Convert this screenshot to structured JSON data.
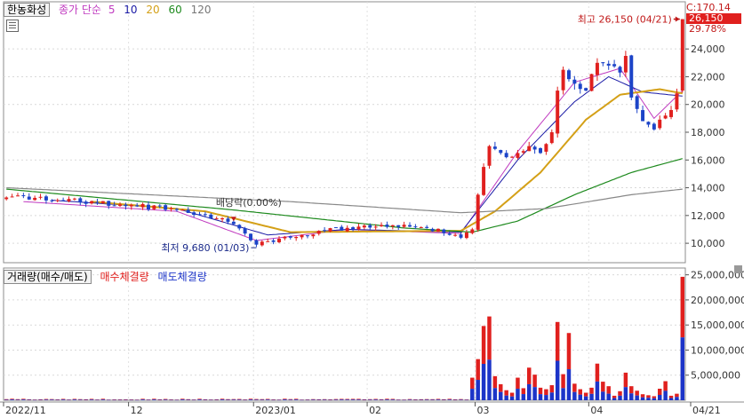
{
  "legend_price": {
    "stock_name": "한농화성",
    "ma_prefix": "종가 단순",
    "ma_periods": [
      "5",
      "10",
      "20",
      "60",
      "120"
    ],
    "ma_colors": [
      "#c03bc0",
      "#1a1aa6",
      "#d4a017",
      "#1e8a1e",
      "#888888"
    ]
  },
  "legend_volume": {
    "label": "거래량(매수/매도)",
    "buy_label": "매수체결량",
    "sell_label": "매도체결량"
  },
  "price_box": {
    "top_value": "C:170.14",
    "current": "26,150",
    "change": "29.78%"
  },
  "colors": {
    "up": "#e0201e",
    "down": "#1c44c8",
    "buy": "#e0201e",
    "sell": "#1c34c8"
  },
  "chart_data": [
    {
      "type": "candlestick",
      "y_ticks": [
        10000,
        12000,
        14000,
        16000,
        18000,
        20000,
        22000,
        24000
      ],
      "y_tick_labels": [
        "10,000",
        "12,000",
        "14,000",
        "16,000",
        "18,000",
        "20,000",
        "22,000",
        "24,000"
      ],
      "ylim": [
        8600,
        27400
      ],
      "x_labels": [
        "2022/11",
        "12",
        "2023/01",
        "02",
        "03",
        "04",
        "04/21"
      ],
      "x_label_days": [
        0,
        22,
        44,
        64,
        83,
        103,
        119
      ],
      "annotations": {
        "high": {
          "text": "최고 26,150 (04/21)",
          "day": 119,
          "value": 26150
        },
        "low": {
          "text": "최저 9,680 (01/03)",
          "day": 44,
          "value": 9680
        },
        "dividend": {
          "text": "배당락(0.00%)",
          "day": 40,
          "value": 12550
        }
      },
      "anchors": [
        [
          0,
          13300
        ],
        [
          10,
          13100
        ],
        [
          20,
          12800
        ],
        [
          30,
          12400
        ],
        [
          38,
          11800
        ],
        [
          42,
          10700
        ],
        [
          44,
          9900
        ],
        [
          50,
          10400
        ],
        [
          56,
          10900
        ],
        [
          62,
          11200
        ],
        [
          68,
          11300
        ],
        [
          74,
          11100
        ],
        [
          79,
          10600
        ],
        [
          80,
          10400
        ],
        [
          82,
          11000
        ],
        [
          83,
          13500
        ],
        [
          84,
          15500
        ],
        [
          85,
          17000
        ],
        [
          86,
          16800
        ],
        [
          88,
          16200
        ],
        [
          90,
          16500
        ],
        [
          92,
          17000
        ],
        [
          94,
          16500
        ],
        [
          96,
          18000
        ],
        [
          97,
          21000
        ],
        [
          98,
          22500
        ],
        [
          100,
          21500
        ],
        [
          102,
          21000
        ],
        [
          104,
          23000
        ],
        [
          106,
          22800
        ],
        [
          108,
          22300
        ],
        [
          109,
          23500
        ],
        [
          110,
          20500
        ],
        [
          112,
          18800
        ],
        [
          114,
          18200
        ],
        [
          116,
          19200
        ],
        [
          117,
          19600
        ],
        [
          118,
          20800
        ],
        [
          119,
          26150
        ]
      ],
      "ma": {
        "ma5": [
          [
            3,
            13000
          ],
          [
            30,
            12300
          ],
          [
            44,
            10200
          ],
          [
            60,
            11000
          ],
          [
            80,
            10700
          ],
          [
            90,
            16600
          ],
          [
            100,
            21600
          ],
          [
            108,
            22600
          ],
          [
            114,
            19000
          ],
          [
            119,
            21000
          ]
        ],
        "ma10": [
          [
            8,
            13100
          ],
          [
            30,
            12500
          ],
          [
            46,
            10600
          ],
          [
            60,
            11000
          ],
          [
            80,
            10800
          ],
          [
            90,
            16000
          ],
          [
            100,
            20200
          ],
          [
            106,
            22000
          ],
          [
            112,
            20900
          ],
          [
            119,
            20600
          ]
        ],
        "ma20": [
          [
            15,
            13000
          ],
          [
            35,
            12300
          ],
          [
            50,
            10800
          ],
          [
            80,
            10900
          ],
          [
            86,
            12300
          ],
          [
            94,
            15100
          ],
          [
            102,
            18900
          ],
          [
            108,
            20700
          ],
          [
            115,
            21100
          ],
          [
            119,
            20800
          ]
        ],
        "ma60": [
          [
            0,
            13900
          ],
          [
            40,
            12400
          ],
          [
            70,
            11100
          ],
          [
            82,
            10800
          ],
          [
            90,
            11600
          ],
          [
            100,
            13500
          ],
          [
            110,
            15100
          ],
          [
            119,
            16100
          ]
        ],
        "ma120": [
          [
            0,
            14000
          ],
          [
            50,
            13000
          ],
          [
            80,
            12200
          ],
          [
            95,
            12500
          ],
          [
            110,
            13500
          ],
          [
            119,
            13900
          ]
        ]
      }
    },
    {
      "type": "bar",
      "series": [
        {
          "name": "매수체결량"
        },
        {
          "name": "매도체결량"
        }
      ],
      "y_ticks": [
        5000000,
        10000000,
        15000000,
        20000000,
        25000000
      ],
      "y_tick_labels": [
        "5,000,000",
        "10,000,000",
        "15,000,000",
        "20,000,000",
        "25,000,000"
      ],
      "ylim": [
        0,
        26000000
      ],
      "volumes": [
        [
          82,
          4500000
        ],
        [
          83,
          8200000
        ],
        [
          84,
          14800000
        ],
        [
          85,
          16700000
        ],
        [
          86,
          4800000
        ],
        [
          87,
          3200000
        ],
        [
          88,
          2000000
        ],
        [
          89,
          1500000
        ],
        [
          90,
          4500000
        ],
        [
          91,
          2400000
        ],
        [
          92,
          6500000
        ],
        [
          93,
          5100000
        ],
        [
          94,
          2500000
        ],
        [
          95,
          2200000
        ],
        [
          96,
          3000000
        ],
        [
          97,
          15600000
        ],
        [
          98,
          5200000
        ],
        [
          99,
          13400000
        ],
        [
          100,
          3300000
        ],
        [
          101,
          2200000
        ],
        [
          102,
          1500000
        ],
        [
          103,
          2500000
        ],
        [
          104,
          7300000
        ],
        [
          105,
          3700000
        ],
        [
          106,
          2800000
        ],
        [
          107,
          900000
        ],
        [
          108,
          1800000
        ],
        [
          109,
          5500000
        ],
        [
          110,
          2800000
        ],
        [
          111,
          1900000
        ],
        [
          112,
          1200000
        ],
        [
          113,
          1000000
        ],
        [
          114,
          800000
        ],
        [
          115,
          2300000
        ],
        [
          116,
          3800000
        ],
        [
          117,
          900000
        ],
        [
          118,
          1300000
        ],
        [
          119,
          24600000
        ]
      ]
    }
  ]
}
